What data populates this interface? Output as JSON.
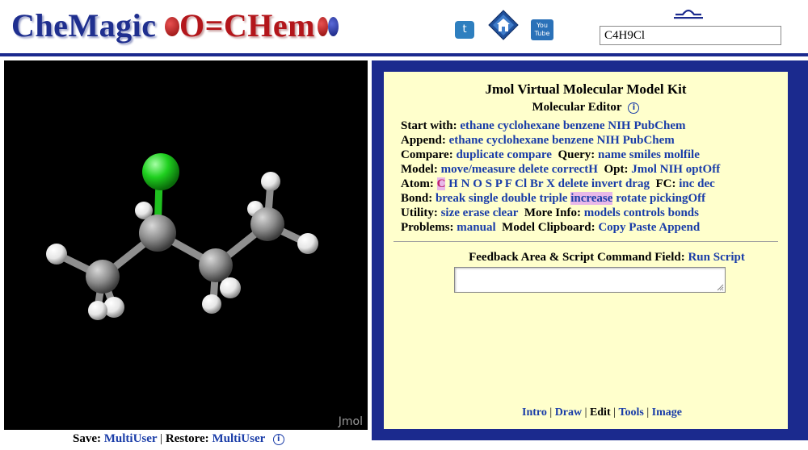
{
  "header": {
    "logo_che": "CheMagic",
    "logo_ochem": "O=CHem",
    "search_value": "C4H9Cl",
    "icons": [
      "twitter-icon",
      "home-icon",
      "youtube-icon",
      "libra-icon"
    ],
    "youtube_text": "You Tube"
  },
  "viewer": {
    "watermark": "Jmol"
  },
  "savebar": {
    "save_label": "Save:",
    "save_link": "MultiUser",
    "separator": "|",
    "restore_label": "Restore:",
    "restore_link": "MultiUser",
    "info": "i"
  },
  "kit": {
    "title": "Jmol Virtual Molecular Model Kit",
    "subtitle": "Molecular Editor",
    "info": "i",
    "rows": {
      "start": {
        "label": "Start with:",
        "links": [
          "ethane",
          "cyclohexane",
          "benzene",
          "NIH",
          "PubChem"
        ]
      },
      "append": {
        "label": "Append:",
        "links": [
          "ethane",
          "cyclohexane",
          "benzene",
          "NIH",
          "PubChem"
        ]
      },
      "compare": {
        "label": "Compare:",
        "links": [
          "duplicate",
          "compare"
        ],
        "label2": "Query:",
        "links2": [
          "name",
          "smiles",
          "molfile"
        ]
      },
      "model": {
        "label": "Model:",
        "links": [
          "move/measure",
          "delete",
          "correctH"
        ],
        "label2": "Opt:",
        "links2": [
          "Jmol",
          "NIH",
          "optOff"
        ]
      },
      "atom": {
        "label": "Atom:",
        "links": [
          "C",
          "H",
          "N",
          "O",
          "S",
          "P",
          "F",
          "Cl",
          "Br",
          "X",
          "delete",
          "invert",
          "drag"
        ],
        "label2": "FC:",
        "links2": [
          "inc",
          "dec"
        ]
      },
      "bond": {
        "label": "Bond:",
        "links": [
          "break",
          "single",
          "double",
          "triple",
          "increase",
          "rotate",
          "pickingOff"
        ]
      },
      "utility": {
        "label": "Utility:",
        "links": [
          "size",
          "erase",
          "clear"
        ],
        "label2": "More Info:",
        "links2": [
          "models",
          "controls",
          "bonds"
        ]
      },
      "problems": {
        "label": "Problems:",
        "links": [
          "manual"
        ],
        "label2": "Model Clipboard:",
        "links2": [
          "Copy",
          "Paste",
          "Append"
        ]
      }
    },
    "feedback_label": "Feedback Area & Script Command Field:",
    "run_script": "Run Script",
    "feedback_value": "",
    "nav": [
      "Intro",
      "Draw",
      "Edit",
      "Tools",
      "Image"
    ],
    "nav_active": "Edit"
  },
  "colors": {
    "navy": "#1b2a8e",
    "link": "#1a3da8",
    "panel": "#ffffcc",
    "chlorine": "#1fd01f",
    "carbon": "#8c8c8c",
    "hydrogen": "#ffffff"
  }
}
